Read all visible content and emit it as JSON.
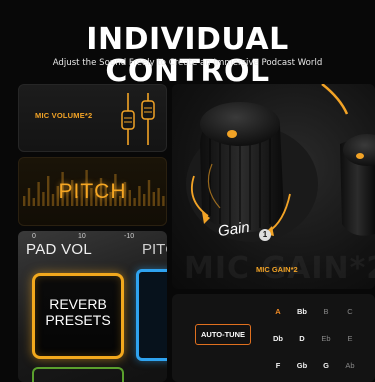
{
  "header": {
    "title": "INDIVIDUAL CONTROL",
    "subtitle": "Adjust the Sound Freely to Create an Immersive Podcast World"
  },
  "mic_volume": {
    "label": "MIC VOLUME*2"
  },
  "pitch": {
    "label": "PITCH"
  },
  "pad": {
    "ticks": [
      "0",
      "10",
      "-10"
    ],
    "vol_label": "PAD VOL",
    "next_label": "PITC",
    "reverb_label": "REVERB PRESETS"
  },
  "gain": {
    "knob_label": "Gain",
    "info_number": "1",
    "mic_gain_label": "MIC GAIN*2",
    "ghost_text": "MIC GAIN*2"
  },
  "autotune": {
    "button_label": "AUTO-TUNE",
    "notes": [
      [
        "A",
        "Bb",
        "B",
        "C"
      ],
      [
        "Db",
        "D",
        "Eb",
        "E"
      ],
      [
        "F",
        "Gb",
        "G",
        "Ab"
      ]
    ]
  },
  "colors": {
    "accent": "#f2a326",
    "autotune_border": "#e0701f",
    "blue_pad": "#2fa3f0",
    "green_pad": "#5aa02d"
  }
}
